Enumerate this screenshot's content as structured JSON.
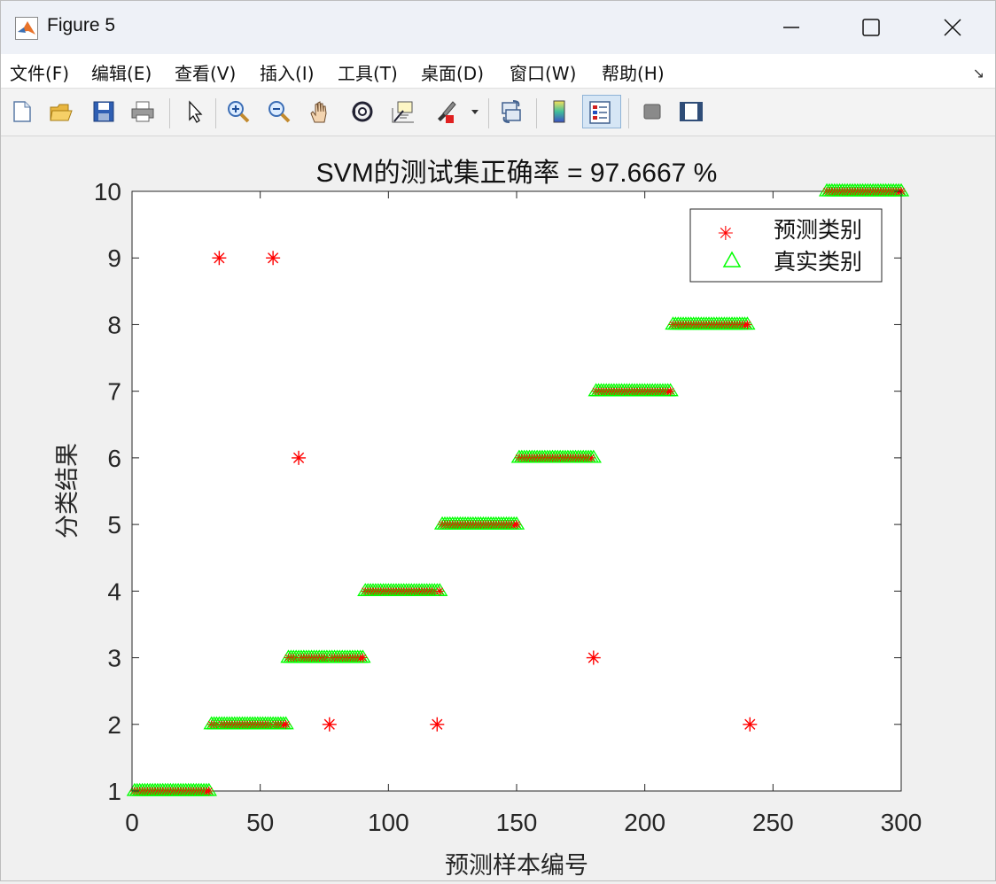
{
  "window": {
    "title": "Figure 5"
  },
  "menu": [
    "文件(F)",
    "编辑(E)",
    "查看(V)",
    "插入(I)",
    "工具(T)",
    "桌面(D)",
    "窗口(W)",
    "帮助(H)"
  ],
  "menu_dock_glyph": "↘",
  "toolbar": [
    "new-figure-icon",
    "open-file-icon",
    "save-icon",
    "print-icon",
    "select-arrow-icon",
    "zoom-in-icon",
    "zoom-out-icon",
    "pan-hand-icon",
    "rotate-3d-icon",
    "data-cursor-icon",
    "brush-icon",
    "brush-dropdown-icon",
    "link-plot-icon",
    "colorbar-icon",
    "legend-icon",
    "hide-plot-tools-icon",
    "show-plot-tools-icon"
  ],
  "colors": {
    "predicted": "#ff0000",
    "actual": "#00ff00",
    "axes": "#262626"
  },
  "chart_data": {
    "type": "scatter",
    "title": "SVM的测试集正确率 = 97.6667 %",
    "xlabel": "预测样本编号",
    "ylabel": "分类结果",
    "xlim": [
      0,
      300
    ],
    "ylim": [
      1,
      10
    ],
    "xticks": [
      0,
      50,
      100,
      150,
      200,
      250,
      300
    ],
    "yticks": [
      1,
      2,
      3,
      4,
      5,
      6,
      7,
      8,
      9,
      10
    ],
    "legend_position": "top-right",
    "class_runs": [
      {
        "class": 1,
        "from": 1,
        "to": 30
      },
      {
        "class": 2,
        "from": 31,
        "to": 60
      },
      {
        "class": 3,
        "from": 61,
        "to": 90
      },
      {
        "class": 4,
        "from": 91,
        "to": 120
      },
      {
        "class": 5,
        "from": 121,
        "to": 150
      },
      {
        "class": 6,
        "from": 151,
        "to": 180
      },
      {
        "class": 7,
        "from": 181,
        "to": 210
      },
      {
        "class": 8,
        "from": 211,
        "to": 240
      },
      {
        "class": 10,
        "from": 271,
        "to": 300
      }
    ],
    "misclassified": [
      {
        "x": 34,
        "predicted": 9
      },
      {
        "x": 55,
        "predicted": 9
      },
      {
        "x": 65,
        "predicted": 6
      },
      {
        "x": 77,
        "predicted": 2
      },
      {
        "x": 119,
        "predicted": 2
      },
      {
        "x": 180,
        "predicted": 3
      },
      {
        "x": 241,
        "predicted": 2
      }
    ],
    "series": [
      {
        "name": "预测类别",
        "marker": "asterisk",
        "color": "#ff0000"
      },
      {
        "name": "真实类别",
        "marker": "triangle",
        "color": "#00ff00"
      }
    ]
  }
}
